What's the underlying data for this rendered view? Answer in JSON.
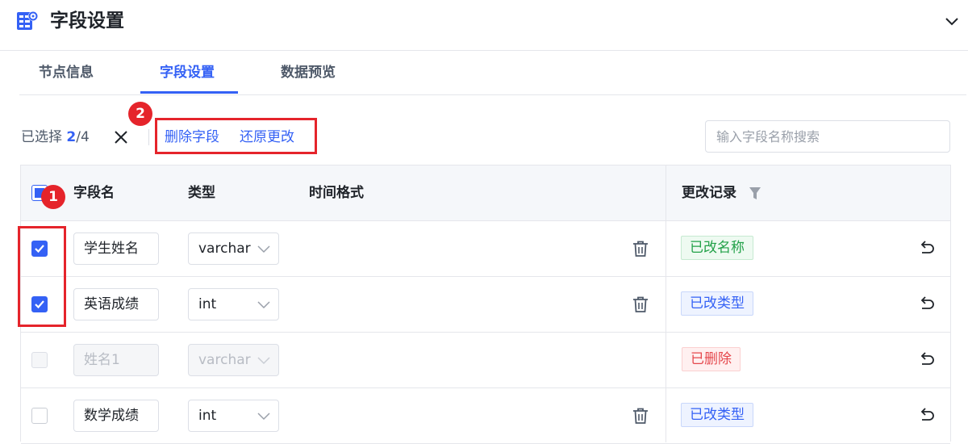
{
  "header": {
    "title": "字段设置",
    "icon": "table-settings-icon",
    "collapse_icon": "chevron-down-icon"
  },
  "tabs": [
    {
      "label": "节点信息",
      "active": false
    },
    {
      "label": "字段设置",
      "active": true
    },
    {
      "label": "数据预览",
      "active": false
    }
  ],
  "toolbar": {
    "selected_prefix": "已选择",
    "selected_count": "2",
    "selected_total": "/4",
    "delete_label": "删除字段",
    "restore_label": "还原更改",
    "search_placeholder": "输入字段名称搜索"
  },
  "table": {
    "columns": {
      "name": "字段名",
      "type": "类型",
      "time_format": "时间格式",
      "change_log": "更改记录"
    },
    "rows": [
      {
        "checked": true,
        "disabled": false,
        "name": "学生姓名",
        "type": "varchar",
        "can_delete": true,
        "change": "已改名称",
        "change_color": "green"
      },
      {
        "checked": true,
        "disabled": false,
        "name": "英语成绩",
        "type": "int",
        "can_delete": true,
        "change": "已改类型",
        "change_color": "blue"
      },
      {
        "checked": false,
        "disabled": true,
        "name": "姓名1",
        "type": "varchar",
        "can_delete": false,
        "change": "已删除",
        "change_color": "red"
      },
      {
        "checked": false,
        "disabled": false,
        "name": "数学成绩",
        "type": "int",
        "can_delete": true,
        "change": "已改类型",
        "change_color": "blue"
      }
    ]
  },
  "annotations": {
    "marker_1": "1",
    "marker_2": "2"
  },
  "colors": {
    "accent": "#3461f5",
    "annotation": "#e5242b",
    "success": "#22a148",
    "danger": "#e5484d"
  }
}
